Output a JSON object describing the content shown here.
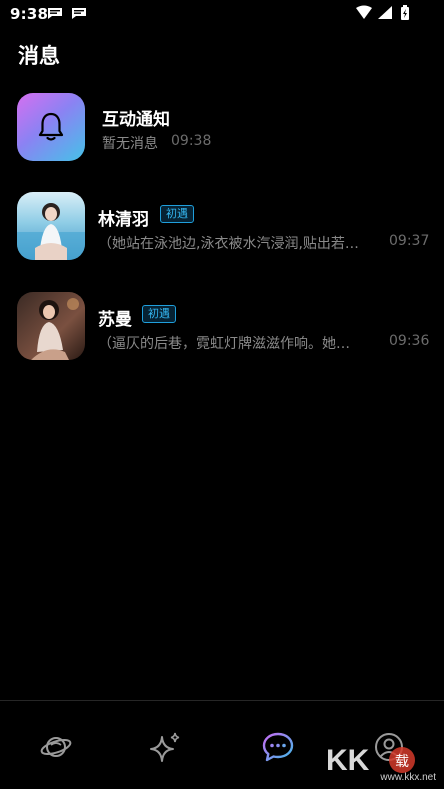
{
  "status_bar": {
    "time": "9:38"
  },
  "header": {
    "title": "消息"
  },
  "notification": {
    "title": "互动通知",
    "subtitle": "暂无消息",
    "time": "09:38"
  },
  "conversations": [
    {
      "name": "林清羽",
      "badge": "初遇",
      "preview": "（她站在泳池边,泳衣被水汽浸润,贴出若…",
      "time": "09:37"
    },
    {
      "name": "苏曼",
      "badge": "初遇",
      "preview": "（逼仄的后巷，霓虹灯牌滋滋作响。她…",
      "time": "09:36"
    }
  ],
  "bottom_nav": {
    "items": [
      "planet-icon",
      "sparkle-icon",
      "chat-icon",
      "profile-icon"
    ],
    "active_index": 2,
    "active_color": "#8b7cf6"
  },
  "watermark": {
    "text": "www.kkx.net"
  }
}
